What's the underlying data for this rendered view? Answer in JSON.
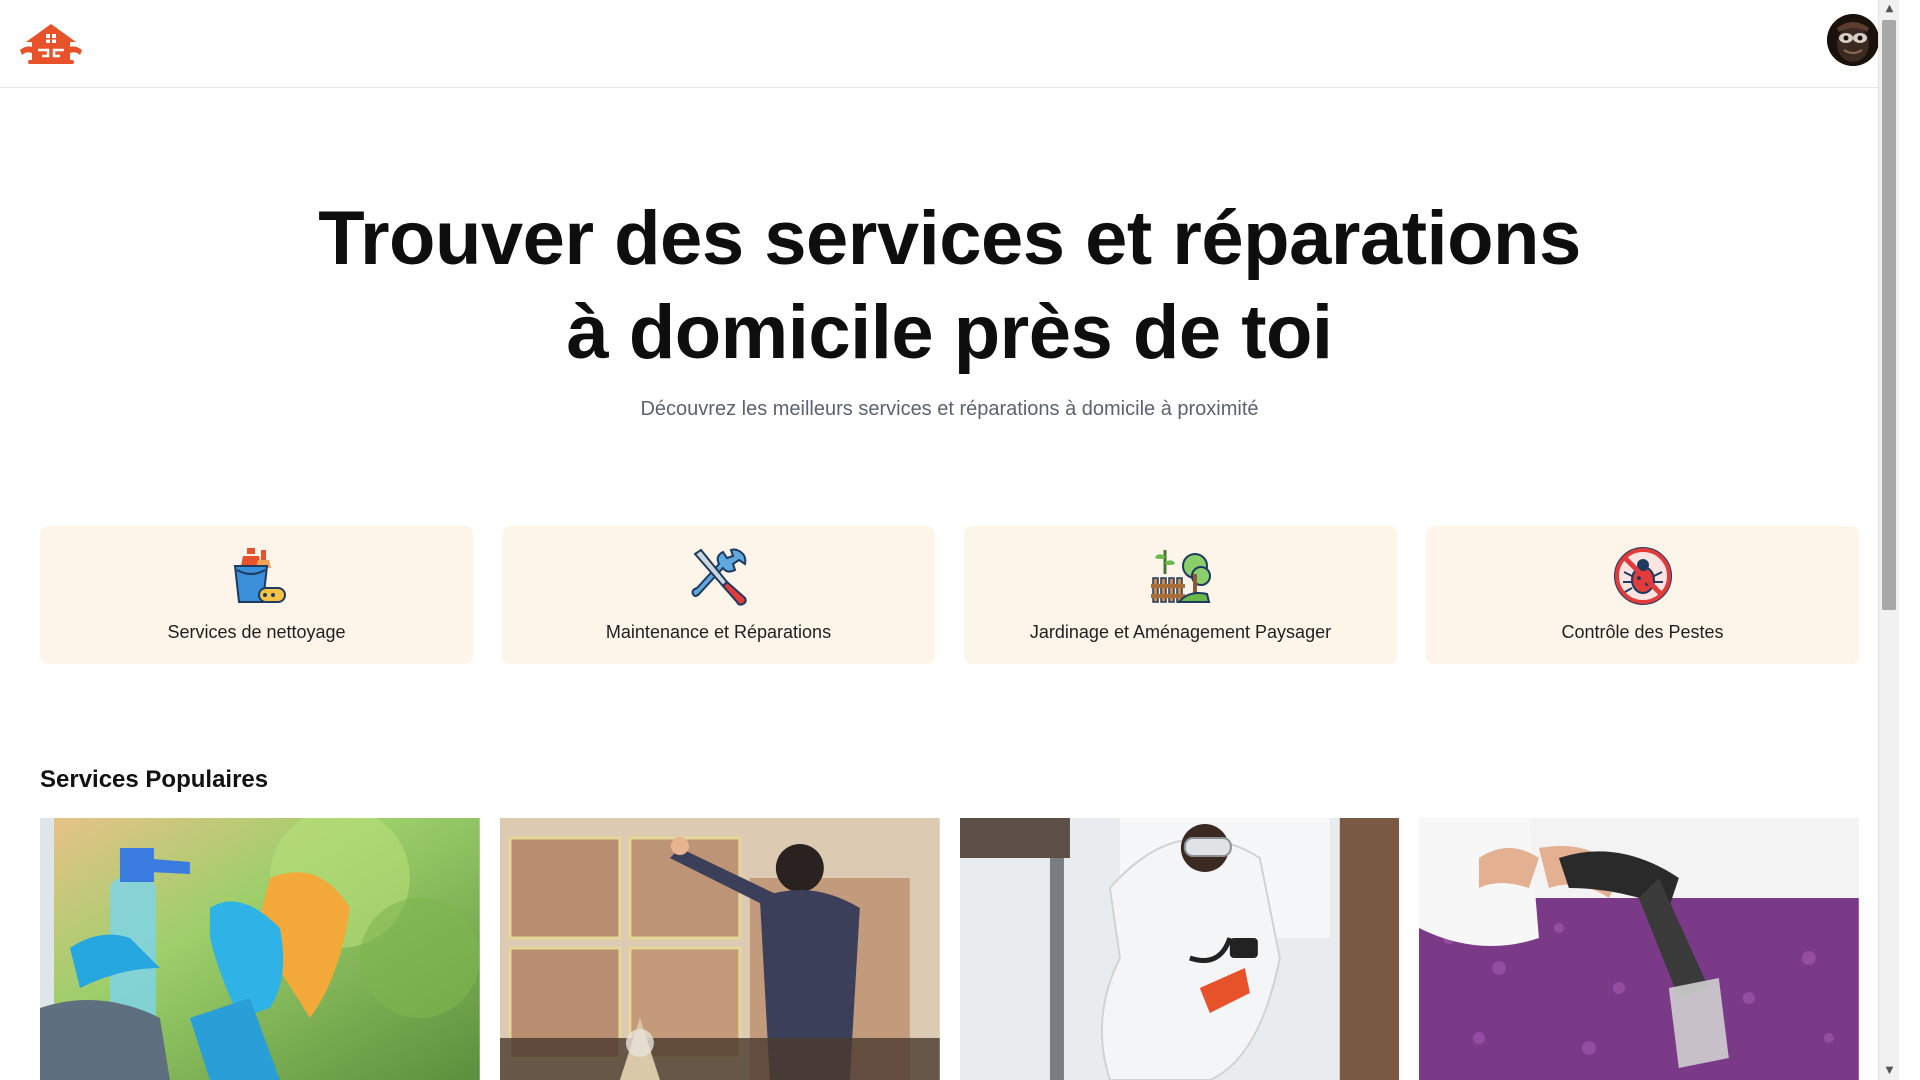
{
  "header": {
    "logo_icon": "house-logo-icon",
    "avatar_icon": "user-avatar"
  },
  "hero": {
    "title_line1": "Trouver des services et réparations",
    "title_line2": "à domicile près de toi",
    "subtitle": "Découvrez les meilleurs services et réparations à domicile à proximité"
  },
  "categories": [
    {
      "label": "Services de nettoyage",
      "icon": "cleaning-supplies-icon"
    },
    {
      "label": "Maintenance et Réparations",
      "icon": "wrench-screwdriver-icon"
    },
    {
      "label": "Jardinage et Aménagement Paysager",
      "icon": "garden-trees-icon"
    },
    {
      "label": "Contrôle des Pestes",
      "icon": "no-bug-icon"
    }
  ],
  "popular": {
    "title": "Services Populaires",
    "items": [
      {
        "image": "window-cleaning-photo"
      },
      {
        "image": "wall-repair-photo"
      },
      {
        "image": "pest-control-photo"
      },
      {
        "image": "carpet-cleaning-photo"
      }
    ]
  },
  "colors": {
    "brand": "#e8522a",
    "category_bg": "#fdf4ea",
    "subtitle": "#5b6270"
  }
}
